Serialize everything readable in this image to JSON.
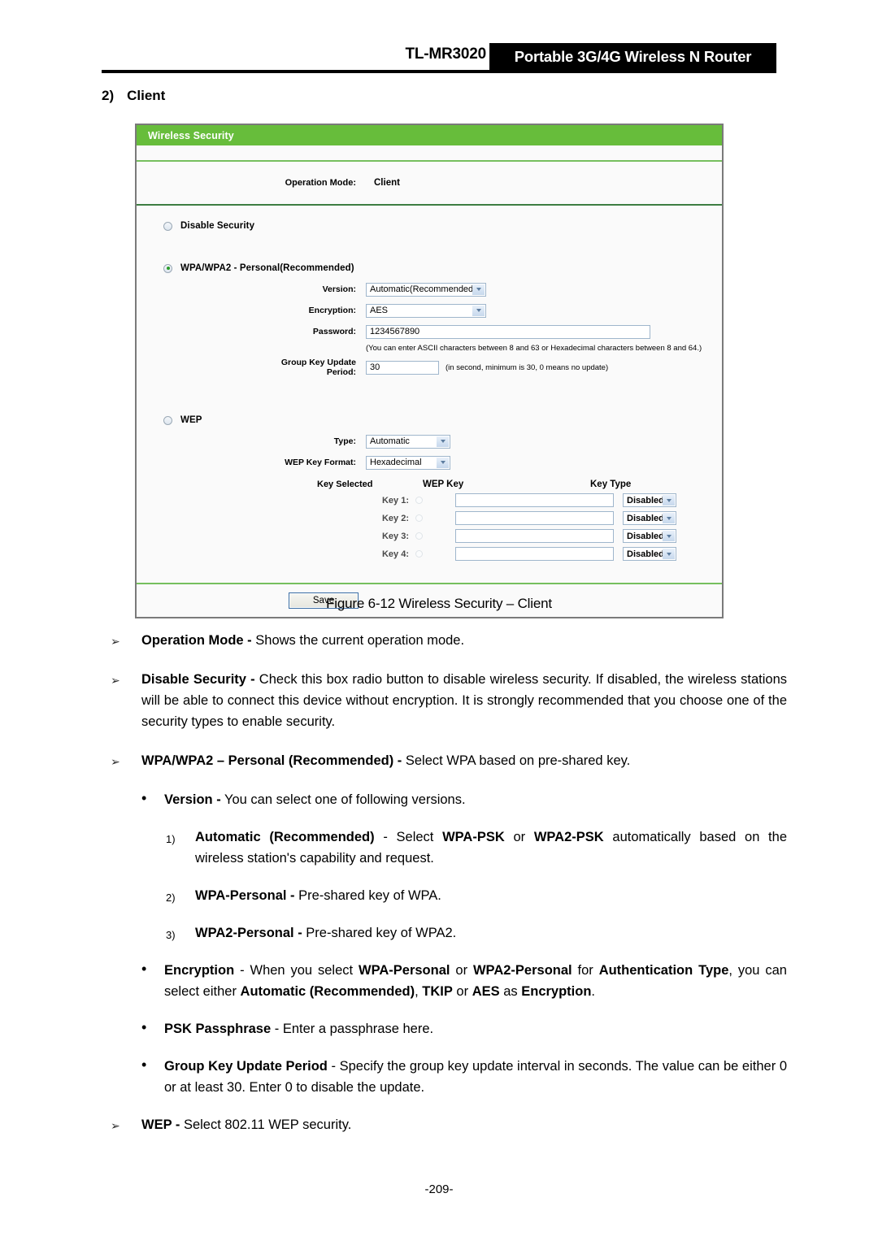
{
  "header": {
    "model": "TL-MR3020",
    "product_title": "Portable 3G/4G Wireless N Router"
  },
  "section": {
    "number": "2)",
    "title": "Client"
  },
  "router_ui": {
    "panel_title": "Wireless Security",
    "operation_mode": {
      "label": "Operation Mode:",
      "value": "Client"
    },
    "disable_security": {
      "label": "Disable Security",
      "selected": false
    },
    "wpa": {
      "label": "WPA/WPA2 - Personal(Recommended)",
      "selected": true,
      "version_label": "Version:",
      "version_value": "Automatic(Recommended)",
      "encryption_label": "Encryption:",
      "encryption_value": "AES",
      "password_label": "Password:",
      "password_value": "1234567890",
      "password_hint": "(You can enter ASCII characters between 8 and 63 or Hexadecimal characters between 8 and 64.)",
      "group_key_label": "Group Key Update Period:",
      "group_key_value": "30",
      "group_key_hint": "(in second, minimum is 30, 0 means no update)"
    },
    "wep": {
      "label": "WEP",
      "selected": false,
      "type_label": "Type:",
      "type_value": "Automatic",
      "format_label": "WEP Key Format:",
      "format_value": "Hexadecimal",
      "columns": {
        "key_selected": "Key Selected",
        "wep_key": "WEP Key",
        "key_type": "Key Type"
      },
      "rows": [
        {
          "name": "Key 1:",
          "key_value": "",
          "key_type": "Disabled"
        },
        {
          "name": "Key 2:",
          "key_value": "",
          "key_type": "Disabled"
        },
        {
          "name": "Key 3:",
          "key_value": "",
          "key_type": "Disabled"
        },
        {
          "name": "Key 4:",
          "key_value": "",
          "key_type": "Disabled"
        }
      ]
    },
    "save_label": "Save"
  },
  "figure_caption": "Figure 6-12 Wireless Security – Client",
  "prose": {
    "operation_mode": {
      "marker": "➢",
      "term": "Operation Mode -",
      "text": " Shows the current operation mode."
    },
    "disable_security": {
      "marker": "➢",
      "term": "Disable Security -",
      "text": " Check this box radio button to disable wireless security. If disabled, the wireless stations will be able to connect this device without encryption. It is strongly recommended that you choose one of the security types to enable security."
    },
    "wpa_personal": {
      "marker": "➢",
      "term": "WPA/WPA2 – Personal (Recommended) -",
      "text": " Select WPA based on pre-shared key."
    },
    "version": {
      "marker": "•",
      "term": "Version -",
      "text": " You can select one of following versions."
    },
    "version_items": [
      {
        "marker": "1)",
        "term": "Automatic (Recommended)",
        "mid1": " - Select ",
        "bold1": "WPA-PSK",
        "mid2": " or ",
        "bold2": "WPA2-PSK",
        "tail": " automatically based on the wireless station's capability and request."
      },
      {
        "marker": "2)",
        "term": "WPA-Personal -",
        "tail": " Pre-shared key of WPA."
      },
      {
        "marker": "3)",
        "term": "WPA2-Personal -",
        "tail": " Pre-shared key of WPA2."
      }
    ],
    "encryption": {
      "marker": "•",
      "term": "Encryption",
      "p1": " - When you select ",
      "b1": "WPA-Personal",
      "p2": " or ",
      "b2": "WPA2-Personal",
      "p3": " for ",
      "b3": "Authentication Type",
      "p4": ", you can select either ",
      "b4": "Automatic (Recommended)",
      "p5": ", ",
      "b5": "TKIP",
      "p6": " or ",
      "b6": "AES",
      "p7": " as ",
      "b7": "Encryption",
      "p8": "."
    },
    "psk_passphrase": {
      "marker": "•",
      "term": "PSK Passphrase",
      "text": " - Enter a passphrase here."
    },
    "group_key_update": {
      "marker": "•",
      "term": "Group Key Update Period",
      "text": " - Specify the group key update interval in seconds. The value can be either 0 or at least 30. Enter 0 to disable the update."
    },
    "wep": {
      "marker": "➢",
      "term": "WEP -",
      "text": " Select 802.11 WEP security."
    }
  },
  "footer": {
    "page_number": "-209-"
  }
}
